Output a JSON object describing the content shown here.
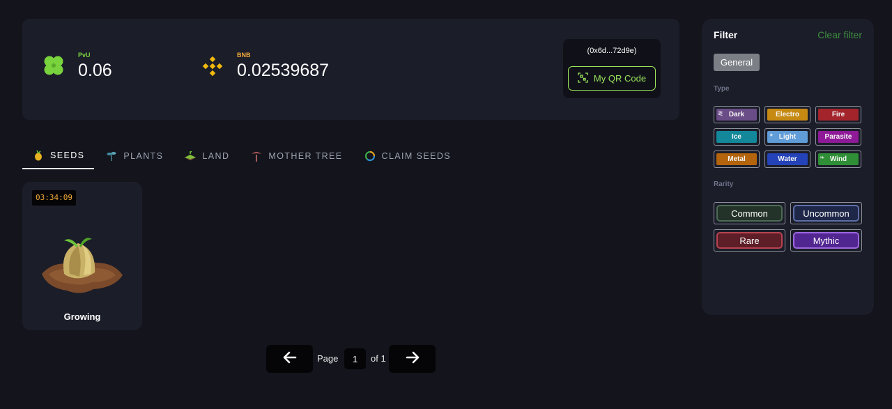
{
  "wallet": {
    "pvu": {
      "label": "PvU",
      "value": "0.06",
      "icon": "clover-icon"
    },
    "bnb": {
      "label": "BNB",
      "value": "0.02539687",
      "icon": "bnb-icon"
    },
    "address": "(0x6d...72d9e)",
    "qr_button_label": "My QR Code"
  },
  "tabs": [
    {
      "label": "SEEDS",
      "icon": "seed-icon",
      "active": true
    },
    {
      "label": "PLANTS",
      "icon": "plant-icon",
      "active": false
    },
    {
      "label": "LAND",
      "icon": "land-icon",
      "active": false
    },
    {
      "label": "MOTHER TREE",
      "icon": "mother-tree-icon",
      "active": false
    },
    {
      "label": "CLAIM SEEDS",
      "icon": "claim-icon",
      "active": false
    }
  ],
  "items": [
    {
      "timer": "03:34:09",
      "status": "Growing"
    }
  ],
  "pagination": {
    "page_label": "Page",
    "current_page": "1",
    "of_label": "of 1"
  },
  "filter": {
    "title": "Filter",
    "clear_label": "Clear filter",
    "general_label": "General",
    "type_label": "Type",
    "rarity_label": "Rarity",
    "types": [
      {
        "label": "Dark",
        "color": "#6a4c86"
      },
      {
        "label": "Electro",
        "color": "#c68a12"
      },
      {
        "label": "Fire",
        "color": "#a3242b"
      },
      {
        "label": "Ice",
        "color": "#13889a"
      },
      {
        "label": "Light",
        "color": "#5f9cd8"
      },
      {
        "label": "Parasite",
        "color": "#8e1a98"
      },
      {
        "label": "Metal",
        "color": "#b3640d"
      },
      {
        "label": "Water",
        "color": "#2443b8"
      },
      {
        "label": "Wind",
        "color": "#2e8f36"
      }
    ],
    "rarities": [
      {
        "label": "Common",
        "color": "#233329",
        "border": "#4d6b55"
      },
      {
        "label": "Uncommon",
        "color": "#1e2748",
        "border": "#5d6ea8"
      },
      {
        "label": "Rare",
        "color": "#5d1e28",
        "border": "#b84350"
      },
      {
        "label": "Mythic",
        "color": "#512691",
        "border": "#9c67e0"
      }
    ]
  }
}
